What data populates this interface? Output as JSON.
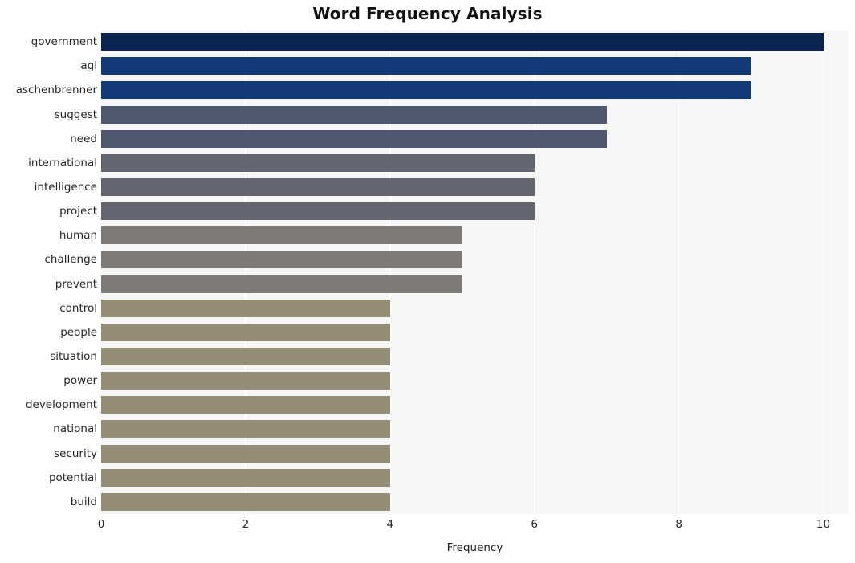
{
  "chart_data": {
    "type": "bar",
    "orientation": "horizontal",
    "title": "Word Frequency Analysis",
    "xlabel": "Frequency",
    "ylabel": "",
    "xlim": [
      0,
      10.35
    ],
    "ylim_categories": 20,
    "grid": true,
    "grid_axis": "x",
    "legend": "none",
    "xticks": [
      0,
      2,
      4,
      6,
      8,
      10
    ],
    "xtick_labels": [
      "0",
      "2",
      "4",
      "6",
      "8",
      "10"
    ],
    "categories": [
      "government",
      "agi",
      "aschenbrenner",
      "suggest",
      "need",
      "international",
      "intelligence",
      "project",
      "human",
      "challenge",
      "prevent",
      "control",
      "people",
      "situation",
      "power",
      "development",
      "national",
      "security",
      "potential",
      "build"
    ],
    "values": [
      10,
      9,
      9,
      7,
      7,
      6,
      6,
      6,
      5,
      5,
      5,
      4,
      4,
      4,
      4,
      4,
      4,
      4,
      4,
      4
    ],
    "bar_colors": [
      "#0a2351",
      "#113a77",
      "#113a77",
      "#4f5770",
      "#4f5770",
      "#63666f",
      "#63666f",
      "#63666f",
      "#7b7a76",
      "#7b7a76",
      "#7b7a76",
      "#958e76",
      "#958e76",
      "#958e76",
      "#958e76",
      "#958e76",
      "#958e76",
      "#958e76",
      "#958e76",
      "#958e76"
    ],
    "plot_background": "#f6f6f7",
    "figure_background": "#ffffff",
    "gridline_color": "#ffffff"
  }
}
